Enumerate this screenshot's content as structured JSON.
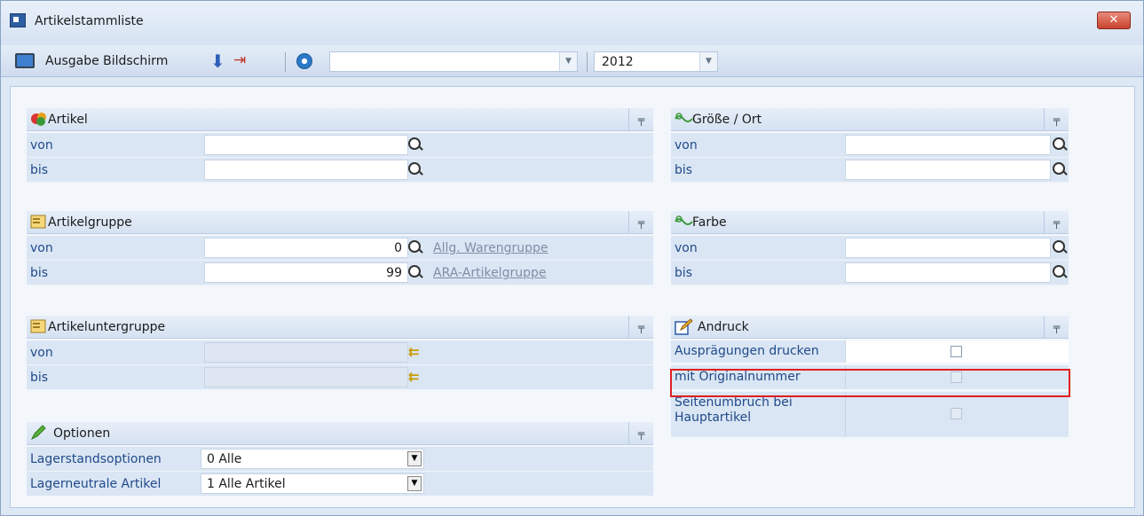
{
  "window": {
    "title": "Artikelstammliste",
    "close_label": "✕"
  },
  "toolbar": {
    "output_label": "Ausgabe Bildschirm",
    "combo_value": "",
    "year_value": "2012"
  },
  "panels": {
    "artikel": {
      "title": "Artikel",
      "von_label": "von",
      "bis_label": "bis",
      "von_value": "",
      "bis_value": ""
    },
    "artikelgruppe": {
      "title": "Artikelgruppe",
      "von_label": "von",
      "bis_label": "bis",
      "von_value": "0",
      "bis_value": "99",
      "von_link": "Allg. Warengruppe",
      "bis_link": "ARA-Artikelgruppe"
    },
    "artikeluntergruppe": {
      "title": "Artikeluntergruppe",
      "von_label": "von",
      "bis_label": "bis"
    },
    "optionen": {
      "title": "Optionen",
      "rows": [
        {
          "label": "Lagerstandsoptionen",
          "value": "0  Alle"
        },
        {
          "label": "Lagerneutrale Artikel",
          "value": "1 Alle Artikel"
        }
      ]
    },
    "groesse_ort": {
      "title": "Größe / Ort",
      "von_label": "von",
      "bis_label": "bis",
      "von_value": "",
      "bis_value": ""
    },
    "farbe": {
      "title": "Farbe",
      "von_label": "von",
      "bis_label": "bis",
      "von_value": "",
      "bis_value": ""
    },
    "andruck": {
      "title": "Andruck",
      "options": [
        {
          "label": "Ausprägungen drucken",
          "checked": false,
          "enabled": true
        },
        {
          "label": "mit Originalnummer",
          "checked": false,
          "enabled": false
        },
        {
          "label": "Seitenumbruch bei Hauptartikel",
          "checked": false,
          "enabled": false
        }
      ]
    }
  },
  "icons": {
    "app": "window-icon",
    "monitor": "monitor-icon",
    "download": "down-arrow-icon",
    "exit": "exit-door-icon",
    "refresh": "refresh-icon",
    "search": "magnifier-icon",
    "pin": "pin-icon"
  },
  "colors": {
    "highlight": "#e02020",
    "close": "#c8432d"
  }
}
